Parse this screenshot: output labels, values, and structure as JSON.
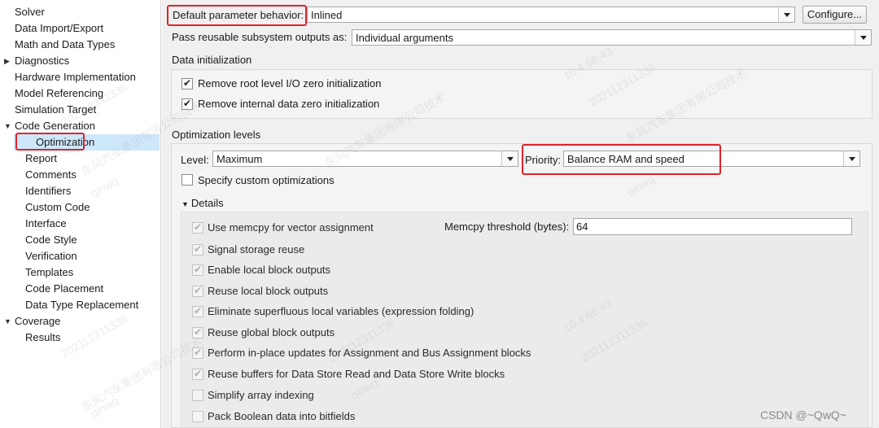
{
  "tree": {
    "items": [
      {
        "label": "Solver",
        "depth": 0,
        "expander": ""
      },
      {
        "label": "Data Import/Export",
        "depth": 0,
        "expander": ""
      },
      {
        "label": "Math and Data Types",
        "depth": 0,
        "expander": ""
      },
      {
        "label": "Diagnostics",
        "depth": 0,
        "expander": "▶"
      },
      {
        "label": "Hardware Implementation",
        "depth": 0,
        "expander": ""
      },
      {
        "label": "Model Referencing",
        "depth": 0,
        "expander": ""
      },
      {
        "label": "Simulation Target",
        "depth": 0,
        "expander": ""
      },
      {
        "label": "Code Generation",
        "depth": 0,
        "expander": "▼"
      },
      {
        "label": "Optimization",
        "depth": 1,
        "expander": "",
        "selected": true
      },
      {
        "label": "Report",
        "depth": 1,
        "expander": ""
      },
      {
        "label": "Comments",
        "depth": 1,
        "expander": ""
      },
      {
        "label": "Identifiers",
        "depth": 1,
        "expander": ""
      },
      {
        "label": "Custom Code",
        "depth": 1,
        "expander": ""
      },
      {
        "label": "Interface",
        "depth": 1,
        "expander": ""
      },
      {
        "label": "Code Style",
        "depth": 1,
        "expander": ""
      },
      {
        "label": "Verification",
        "depth": 1,
        "expander": ""
      },
      {
        "label": "Templates",
        "depth": 1,
        "expander": ""
      },
      {
        "label": "Code Placement",
        "depth": 1,
        "expander": ""
      },
      {
        "label": "Data Type Replacement",
        "depth": 1,
        "expander": ""
      },
      {
        "label": "Coverage",
        "depth": 0,
        "expander": "▼"
      },
      {
        "label": "Results",
        "depth": 1,
        "expander": ""
      }
    ]
  },
  "top": {
    "default_param_label": "Default parameter behavior:",
    "default_param_value": "Inlined",
    "configure_label": "Configure...",
    "pass_reusable_label": "Pass reusable subsystem outputs as:",
    "pass_reusable_value": "Individual arguments"
  },
  "data_init": {
    "section_label": "Data initialization",
    "remove_root_label": "Remove root level I/O zero initialization",
    "remove_root_checked": true,
    "remove_internal_label": "Remove internal data zero initialization",
    "remove_internal_checked": true
  },
  "opt_levels": {
    "section_label": "Optimization levels",
    "level_label": "Level:",
    "level_value": "Maximum",
    "priority_label": "Priority:",
    "priority_value": "Balance RAM and speed",
    "specify_custom_label": "Specify custom optimizations",
    "details_label": "Details",
    "memcpy_threshold_label": "Memcpy threshold (bytes):",
    "memcpy_threshold_value": "64",
    "details_items": [
      {
        "label": "Use memcpy for vector assignment",
        "checked": true
      },
      {
        "label": "Signal storage reuse",
        "checked": true
      },
      {
        "label": "Enable local block outputs",
        "checked": true
      },
      {
        "label": "Reuse local block outputs",
        "checked": true
      },
      {
        "label": "Eliminate superfluous local variables (expression folding)",
        "checked": true
      },
      {
        "label": "Reuse global block outputs",
        "checked": true
      },
      {
        "label": "Perform in-place updates for Assignment and Bus Assignment blocks",
        "checked": true
      },
      {
        "label": "Reuse buffers for Data Store Read and Data Store Write blocks",
        "checked": true
      },
      {
        "label": "Simplify array indexing",
        "checked": false
      },
      {
        "label": "Pack Boolean data into bitfields",
        "checked": false
      }
    ]
  },
  "watermark": {
    "line_a": "20211231​1336",
    "line_b": "东风汽车集团有限公司技术",
    "line_c": "qinwq",
    "line_d": "10.4.66.43"
  },
  "csdn_label": "CSDN @~QwQ~",
  "colors": {
    "highlight": "#e0232b",
    "selection": "#cde8fb"
  }
}
